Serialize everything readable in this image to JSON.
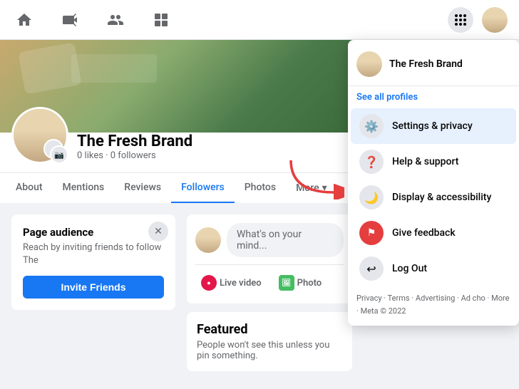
{
  "nav": {
    "icons": [
      "home",
      "video",
      "people",
      "pages",
      "grid",
      "avatar"
    ]
  },
  "profile": {
    "name": "The Fresh Brand",
    "meta": "0 likes · 0 followers",
    "cover_alt": "Cover photo with plants and flowers"
  },
  "tabs": [
    {
      "label": "About",
      "active": false
    },
    {
      "label": "Mentions",
      "active": false
    },
    {
      "label": "Reviews",
      "active": false
    },
    {
      "label": "Followers",
      "active": true
    },
    {
      "label": "Photos",
      "active": false
    },
    {
      "label": "More",
      "active": false
    }
  ],
  "audience_card": {
    "title": "Page audience",
    "description": "Reach by inviting friends to follow The",
    "invite_label": "Invite Friends"
  },
  "composer": {
    "placeholder": "What's on your mind...",
    "live_label": "Live video",
    "photo_label": "Photo"
  },
  "featured": {
    "title": "Featured",
    "description": "People won't see this unless you pin something."
  },
  "dropdown": {
    "user_name": "The Fresh Brand",
    "see_all": "See all profiles",
    "items": [
      {
        "icon": "⚙",
        "label": "Settings & privacy",
        "active": true
      },
      {
        "icon": "❓",
        "label": "Help & support",
        "active": false
      },
      {
        "icon": "🌙",
        "label": "Display & accessibility",
        "active": false
      },
      {
        "icon": "⚑",
        "label": "Give feedback",
        "active": false
      },
      {
        "icon": "⎋",
        "label": "Log Out",
        "active": false
      }
    ],
    "footer": "Privacy · Terms · Advertising · Ad cho · More · Meta © 2022"
  }
}
